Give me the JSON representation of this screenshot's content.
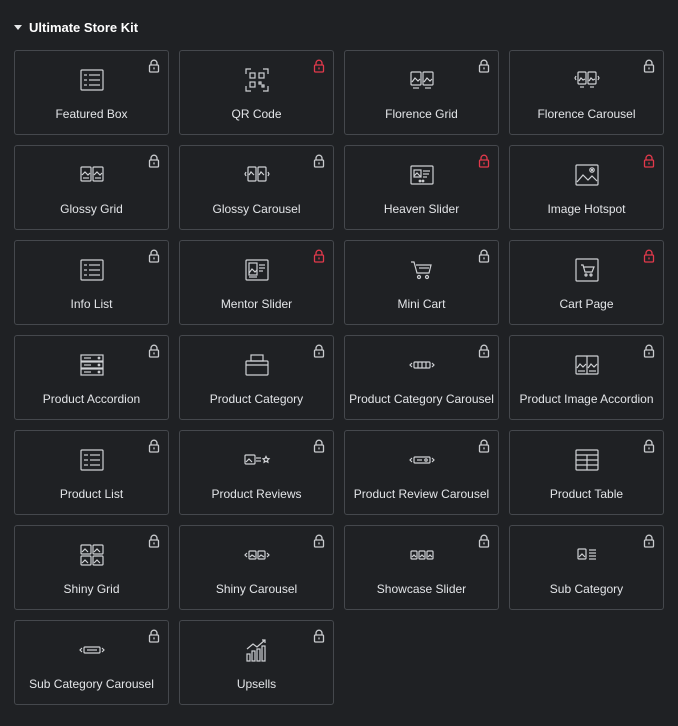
{
  "section": {
    "title": "Ultimate Store Kit"
  },
  "colors": {
    "pro_lock": "#c9cbce",
    "locked_lock": "#e2394b",
    "card_border": "#45484d"
  },
  "widgets": [
    {
      "label": "Featured Box",
      "icon": "featured-box-icon",
      "lock": "gray"
    },
    {
      "label": "QR Code",
      "icon": "qr-code-icon",
      "lock": "red"
    },
    {
      "label": "Florence Grid",
      "icon": "florence-grid-icon",
      "lock": "gray"
    },
    {
      "label": "Florence Carousel",
      "icon": "florence-carousel-icon",
      "lock": "gray"
    },
    {
      "label": "Glossy Grid",
      "icon": "glossy-grid-icon",
      "lock": "gray"
    },
    {
      "label": "Glossy Carousel",
      "icon": "glossy-carousel-icon",
      "lock": "gray"
    },
    {
      "label": "Heaven Slider",
      "icon": "heaven-slider-icon",
      "lock": "red"
    },
    {
      "label": "Image Hotspot",
      "icon": "image-hotspot-icon",
      "lock": "red"
    },
    {
      "label": "Info List",
      "icon": "info-list-icon",
      "lock": "gray"
    },
    {
      "label": "Mentor Slider",
      "icon": "mentor-slider-icon",
      "lock": "red"
    },
    {
      "label": "Mini Cart",
      "icon": "mini-cart-icon",
      "lock": "gray"
    },
    {
      "label": "Cart Page",
      "icon": "cart-page-icon",
      "lock": "red"
    },
    {
      "label": "Product Accordion",
      "icon": "product-accordion-icon",
      "lock": "gray"
    },
    {
      "label": "Product Category",
      "icon": "product-category-icon",
      "lock": "gray"
    },
    {
      "label": "Product Category Carousel",
      "icon": "product-category-carousel-icon",
      "lock": "gray"
    },
    {
      "label": "Product Image Accordion",
      "icon": "product-image-accordion-icon",
      "lock": "gray"
    },
    {
      "label": "Product List",
      "icon": "product-list-icon",
      "lock": "gray"
    },
    {
      "label": "Product Reviews",
      "icon": "product-reviews-icon",
      "lock": "gray"
    },
    {
      "label": "Product Review Carousel",
      "icon": "product-review-carousel-icon",
      "lock": "gray"
    },
    {
      "label": "Product Table",
      "icon": "product-table-icon",
      "lock": "gray"
    },
    {
      "label": "Shiny Grid",
      "icon": "shiny-grid-icon",
      "lock": "gray"
    },
    {
      "label": "Shiny Carousel",
      "icon": "shiny-carousel-icon",
      "lock": "gray"
    },
    {
      "label": "Showcase Slider",
      "icon": "showcase-slider-icon",
      "lock": "gray"
    },
    {
      "label": "Sub Category",
      "icon": "sub-category-icon",
      "lock": "gray"
    },
    {
      "label": "Sub Category Carousel",
      "icon": "sub-category-carousel-icon",
      "lock": "gray"
    },
    {
      "label": "Upsells",
      "icon": "upsells-icon",
      "lock": "gray"
    }
  ]
}
